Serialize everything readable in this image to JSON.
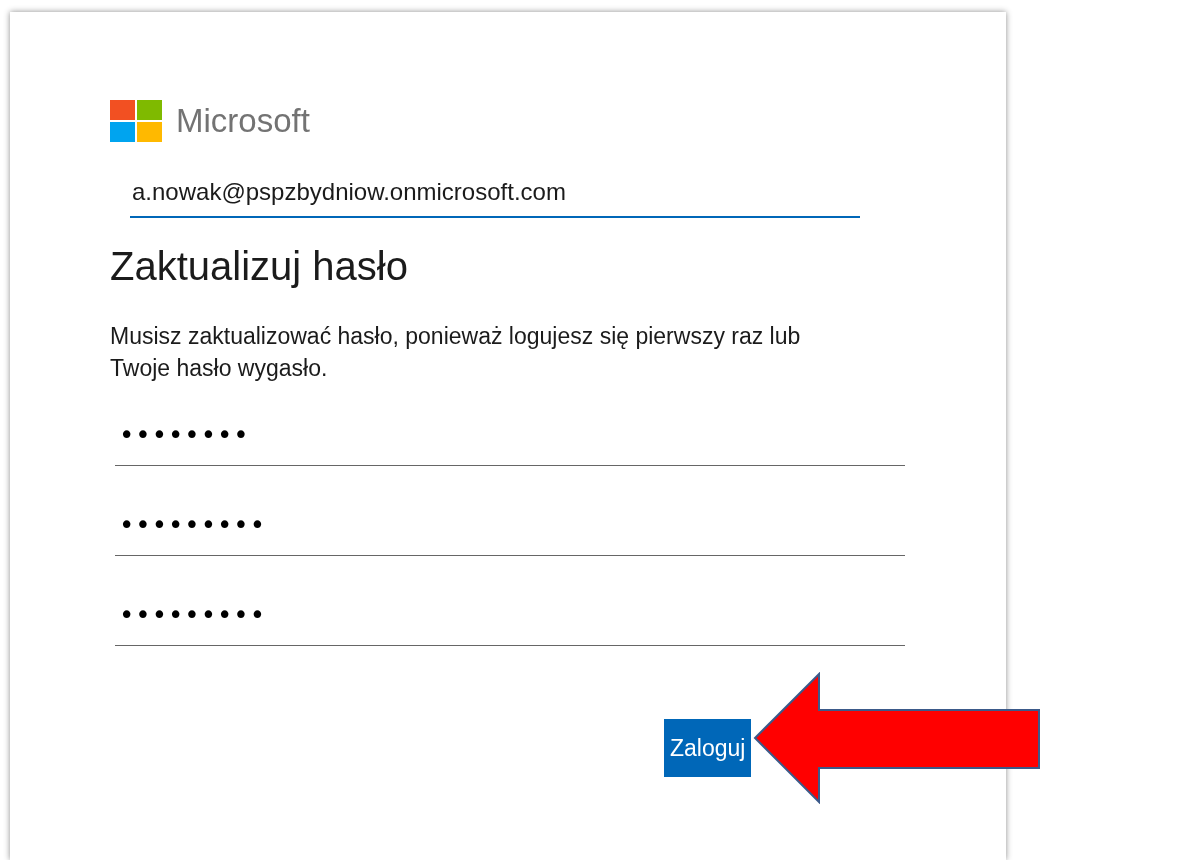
{
  "brand": {
    "name": "Microsoft"
  },
  "account": {
    "value": "a.nowak@pspzbydniow.onmicrosoft.com",
    "focused": true
  },
  "heading": "Zaktualizuj hasło",
  "message": "Musisz zaktualizować hasło, ponieważ logujesz się pierwszy raz lub Twoje hasło wygasło.",
  "password_fields": [
    {
      "value": "••••••••"
    },
    {
      "value": "•••••••••"
    },
    {
      "value": "•••••••••"
    }
  ],
  "submit_button": "Zaloguj"
}
